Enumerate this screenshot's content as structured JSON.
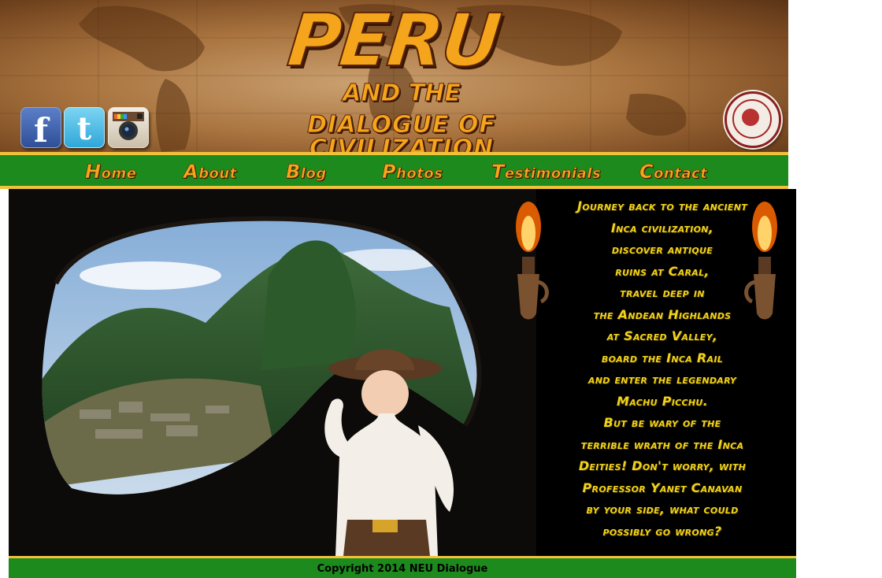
{
  "header": {
    "title": "PERU",
    "title_and": "AND THE",
    "subtitle": "DIALOGUE OF CIVILIZATION",
    "social": {
      "facebook_glyph": "f",
      "twitter_glyph": "t"
    }
  },
  "nav": {
    "items": [
      {
        "label": "Home"
      },
      {
        "label": "About"
      },
      {
        "label": "Blog"
      },
      {
        "label": "Photos"
      },
      {
        "label": "Testimonials"
      },
      {
        "label": "Contact"
      }
    ]
  },
  "promo": {
    "lines": [
      "Journey back to the ancient",
      "Inca civilization,",
      "discover antique",
      "ruins at Caral,",
      "travel deep in",
      "the Andean Highlands",
      "at Sacred Valley,",
      "board the Inca Rail",
      "and enter the legendary",
      "Machu Picchu.",
      "But be wary of the",
      "terrible wrath of the Inca",
      "Deities! Don't worry, with",
      "Professor Yanet Canavan",
      "by your side, what could",
      "possibly go wrong?"
    ]
  },
  "footer": {
    "text": "Copyright 2014 NEU Dialogue"
  },
  "icons": {
    "facebook": "facebook-icon",
    "twitter": "twitter-icon",
    "instagram": "instagram-icon",
    "seal": "university-seal-icon",
    "torch": "torch-icon"
  },
  "colors": {
    "nav_green": "#1d8a1d",
    "nav_border_gold": "#f0c23a",
    "title_orange": "#f4a51c",
    "promo_yellow": "#f2d21a"
  }
}
